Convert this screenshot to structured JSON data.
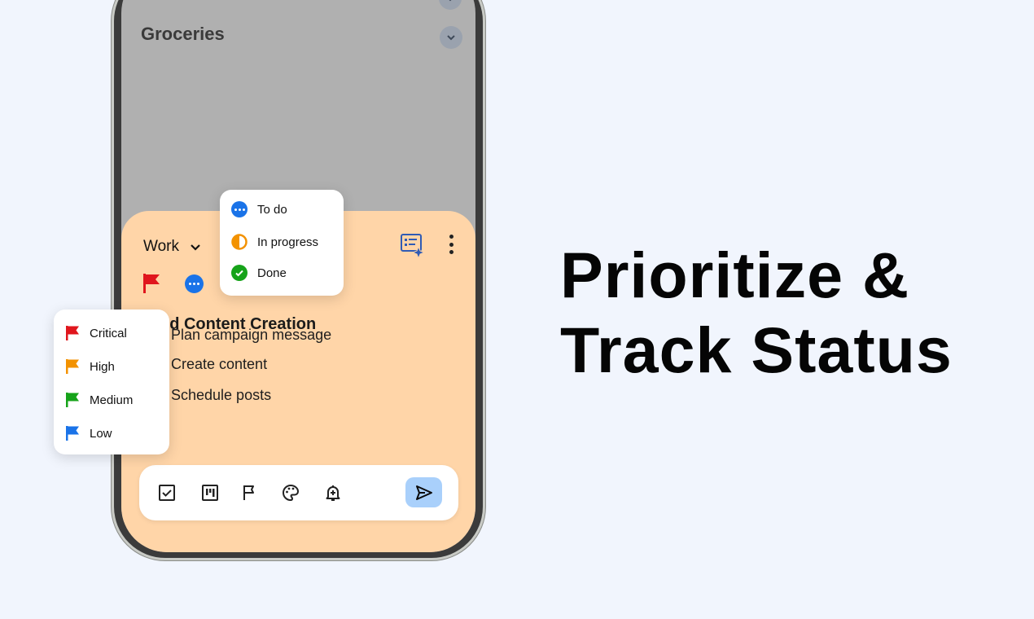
{
  "colors": {
    "background": "#f1f5fd",
    "sheet": "#ffd5a8",
    "critical": "#e0161d",
    "high": "#f39200",
    "medium": "#16a31a",
    "low": "#1a73e8",
    "send": "#a9d0fb"
  },
  "headline": {
    "line1": "Prioritize &",
    "line2": "Track Status"
  },
  "list": {
    "groceries_title": "Groceries"
  },
  "note": {
    "category": "Work",
    "title": "nd Content Creation",
    "tasks": [
      "Plan campaign message",
      "Create content",
      "Schedule posts"
    ]
  },
  "status_menu": {
    "items": [
      {
        "label": "To do",
        "icon": "todo-icon"
      },
      {
        "label": "In progress",
        "icon": "in-progress-icon"
      },
      {
        "label": "Done",
        "icon": "done-icon"
      }
    ]
  },
  "priority_menu": {
    "items": [
      {
        "label": "Critical",
        "icon": "flag-icon"
      },
      {
        "label": "High",
        "icon": "flag-icon"
      },
      {
        "label": "Medium",
        "icon": "flag-icon"
      },
      {
        "label": "Low",
        "icon": "flag-icon"
      }
    ]
  },
  "toolbar": {
    "icons": [
      "checkbox-icon",
      "board-icon",
      "flag-outline-icon",
      "palette-icon",
      "add-reminder-icon",
      "send-icon"
    ]
  }
}
